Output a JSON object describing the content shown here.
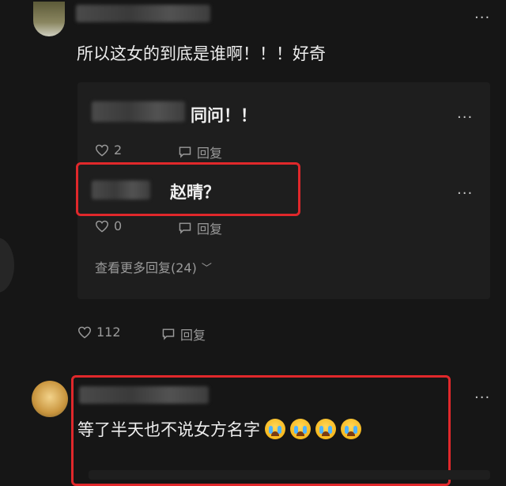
{
  "top_comment": {
    "text": "所以这女的到底是谁啊！！！好奇",
    "likes": "112",
    "reply_label": "回复",
    "more_icon": "more-dots-icon"
  },
  "replies": [
    {
      "text": "同问！！",
      "likes": "2",
      "reply_label": "回复"
    },
    {
      "text": "赵晴？",
      "likes": "0",
      "reply_label": "回复"
    }
  ],
  "view_more": "查看更多回复(24)",
  "second_comment": {
    "text": "等了半天也不说女方名字",
    "emojis": [
      "crying-face-icon",
      "crying-face-icon",
      "crying-face-icon",
      "crying-face-icon"
    ]
  },
  "colors": {
    "background": "#161616",
    "reply_panel": "#1e1e1e",
    "highlight_border": "#e0282b",
    "meta_text": "#9a9a9a"
  }
}
